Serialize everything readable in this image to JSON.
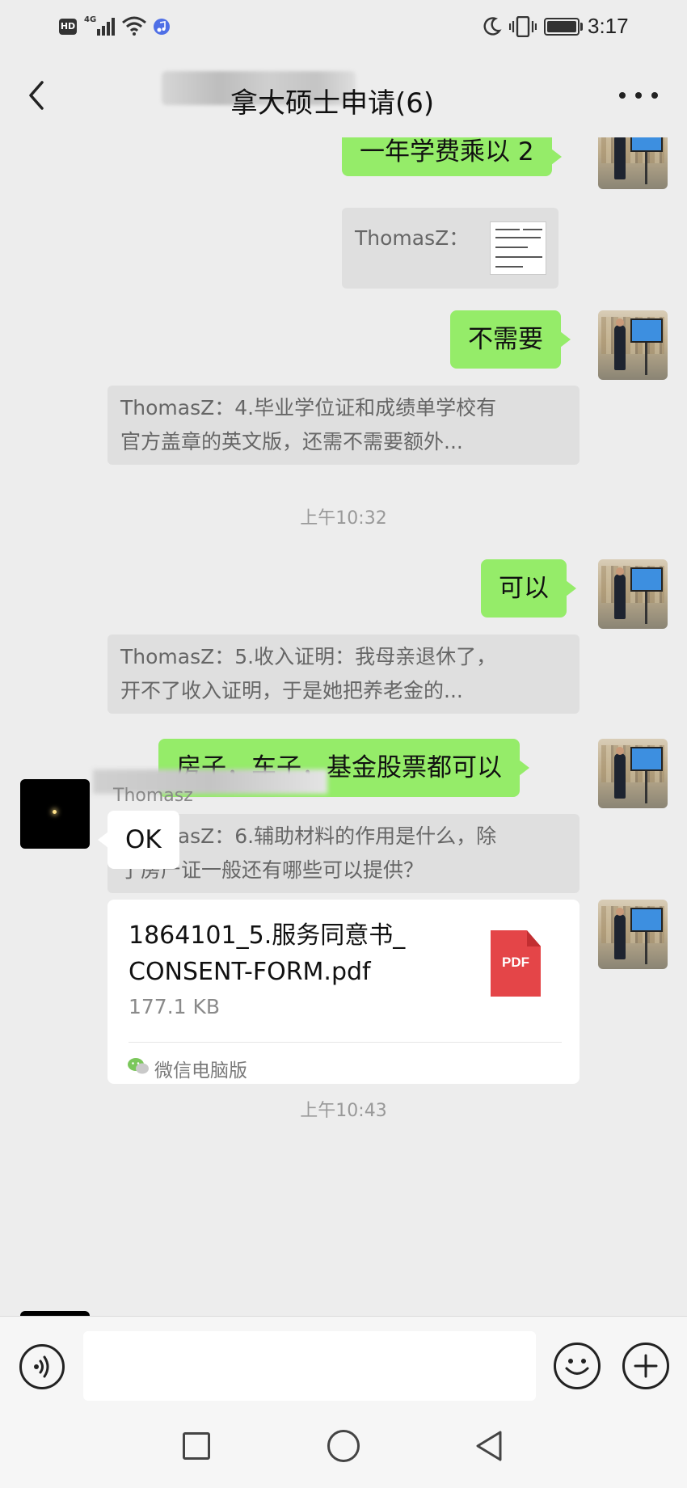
{
  "status_bar": {
    "hd": "HD",
    "network": "4G",
    "time": "3:17",
    "icons": [
      "signal-icon",
      "wifi-icon",
      "music-icon",
      "moon-icon",
      "vibrate-icon",
      "battery-icon"
    ]
  },
  "header": {
    "title": "拿大硕士申请(6)",
    "back_icon": "chevron-left-icon",
    "more_icon": "more-icon"
  },
  "messages": {
    "m1": {
      "text": "一年学费乘以 2"
    },
    "q1": {
      "text": "ThomasZ："
    },
    "m2": {
      "text": "不需要"
    },
    "q2": {
      "line1": "ThomasZ：4.毕业学位证和成绩单学校有",
      "line2": "官方盖章的英文版，还需不需要额外..."
    },
    "t1": {
      "text": "上午10:32"
    },
    "m3": {
      "text": "可以"
    },
    "q3": {
      "line1": "ThomasZ：5.收入证明：我母亲退休了，",
      "line2": "开不了收入证明，于是她把养老金的..."
    },
    "m4": {
      "text": "房子，车子，基金股票都可以"
    },
    "q4": {
      "line1": "ThomasZ：6.辅助材料的作用是什么，除",
      "line2": "了房产证一般还有哪些可以提供？"
    },
    "sender": {
      "name": "Thomasz"
    },
    "m5": {
      "text": "OK"
    },
    "file": {
      "name": "1864101_5.服务同意书_\nCONSENT-FORM.pdf",
      "size": "177.1 KB",
      "type_label": "PDF",
      "source": "微信电脑版"
    },
    "t2": {
      "text": "上午10:43"
    }
  },
  "input_bar": {
    "placeholder": "",
    "icons": [
      "voice-icon",
      "emoji-icon",
      "plus-icon"
    ]
  },
  "nav_bar": {
    "icons": [
      "recent-apps-icon",
      "home-icon",
      "back-icon"
    ]
  },
  "colors": {
    "background": "#ededed",
    "sent_bubble": "#95ec69",
    "received_bubble": "#ffffff",
    "quote_bg": "#dfdfdf",
    "pdf_red": "#e44548"
  }
}
